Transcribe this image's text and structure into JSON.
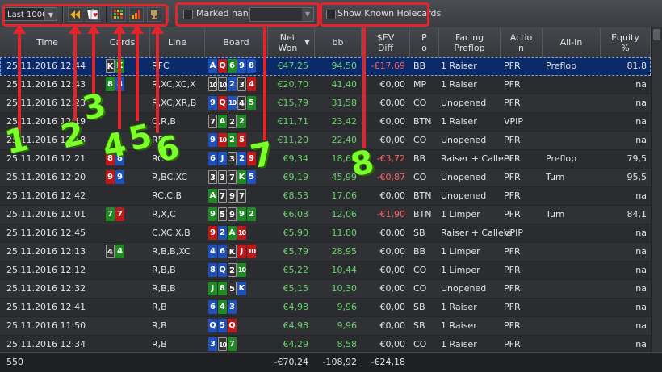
{
  "toolbar": {
    "filter_select": "Last 1000",
    "marked_hands_label": "Marked hands",
    "marked_hands_value": "",
    "show_known_label": "Show Known Holecards"
  },
  "columns": [
    {
      "key": "time",
      "label": "Time"
    },
    {
      "key": "cards",
      "label": "Cards"
    },
    {
      "key": "line",
      "label": "Line"
    },
    {
      "key": "board",
      "label": "Board"
    },
    {
      "key": "net",
      "label": "Net Won"
    },
    {
      "key": "bb",
      "label": "bb"
    },
    {
      "key": "ev",
      "label": "$EV Diff"
    },
    {
      "key": "pos",
      "label": "P o"
    },
    {
      "key": "facing",
      "label": "Facing Preflop"
    },
    {
      "key": "action",
      "label": "Actio n"
    },
    {
      "key": "allin",
      "label": "All-In"
    },
    {
      "key": "equity",
      "label": "Equity %"
    }
  ],
  "rows": [
    {
      "time": "25.11.2016 12:44",
      "cards": [
        [
          "K",
          "s"
        ],
        [
          "K",
          "c"
        ]
      ],
      "line": "RFC",
      "board": [
        [
          "A",
          "d"
        ],
        [
          "Q",
          "h"
        ],
        [
          "6",
          "c"
        ],
        [
          "9",
          "d"
        ],
        [
          "8",
          "d"
        ]
      ],
      "net": "€47,25",
      "bb": "94,50",
      "ev": "-€17,69",
      "ev_neg": true,
      "pos": "BB",
      "facing": "1 Raiser",
      "action": "PFR",
      "allin": "Preflop",
      "equity": "81,8"
    },
    {
      "time": "25.11.2016 12:43",
      "cards": [
        [
          "8",
          "c"
        ],
        [
          "8",
          "d"
        ]
      ],
      "line": "R,XC,XC,X",
      "board": [
        [
          "10",
          "s"
        ],
        [
          "10",
          "s"
        ],
        [
          "2",
          "d"
        ],
        [
          "3",
          "s"
        ],
        [
          "4",
          "h"
        ]
      ],
      "net": "€20,70",
      "bb": "41,40",
      "ev": "€0,00",
      "pos": "MP",
      "facing": "1 Raiser",
      "action": "PFR",
      "allin": "",
      "equity": "na"
    },
    {
      "time": "25.11.2016 12:23",
      "cards": [],
      "line": "R,XC,XR,B",
      "board": [
        [
          "9",
          "d"
        ],
        [
          "Q",
          "h"
        ],
        [
          "10",
          "d"
        ],
        [
          "4",
          "s"
        ],
        [
          "5",
          "c"
        ]
      ],
      "net": "€15,79",
      "bb": "31,58",
      "ev": "€0,00",
      "pos": "CO",
      "facing": "Unopened",
      "action": "PFR",
      "allin": "",
      "equity": "na"
    },
    {
      "time": "25.11.2016 12:19",
      "cards": [],
      "line": "C,R,B",
      "board": [
        [
          "7",
          "s"
        ],
        [
          "A",
          "c"
        ],
        [
          "2",
          "s"
        ],
        [
          "2",
          "c"
        ]
      ],
      "net": "€11,71",
      "bb": "23,42",
      "ev": "€0,00",
      "pos": "BTN",
      "facing": "1 Raiser",
      "action": "VPIP",
      "allin": "",
      "equity": "na"
    },
    {
      "time": "25.11.2016 12:18",
      "cards": [],
      "line": "RB",
      "board": [
        [
          "9",
          "d"
        ],
        [
          "10",
          "h"
        ],
        [
          "2",
          "c"
        ],
        [
          "5",
          "h"
        ]
      ],
      "net": "€11,20",
      "bb": "22,40",
      "ev": "€0,00",
      "pos": "CO",
      "facing": "Unopened",
      "action": "PFR",
      "allin": "",
      "equity": "na"
    },
    {
      "time": "25.11.2016 12:21",
      "cards": [
        [
          "8",
          "h"
        ],
        [
          "8",
          "d"
        ]
      ],
      "line": "RC",
      "board": [
        [
          "6",
          "d"
        ],
        [
          "J",
          "d"
        ],
        [
          "3",
          "s"
        ],
        [
          "2",
          "d"
        ],
        [
          "9",
          "h"
        ]
      ],
      "net": "€9,34",
      "bb": "18,68",
      "ev": "-€3,72",
      "ev_neg": true,
      "pos": "BB",
      "facing": "Raiser + Callers",
      "action": "PFR",
      "allin": "Preflop",
      "equity": "79,5"
    },
    {
      "time": "25.11.2016 12:20",
      "cards": [
        [
          "9",
          "h"
        ],
        [
          "9",
          "d"
        ]
      ],
      "line": "R,BC,XC",
      "board": [
        [
          "3",
          "s"
        ],
        [
          "3",
          "s"
        ],
        [
          "7",
          "s"
        ],
        [
          "K",
          "c"
        ],
        [
          "5",
          "d"
        ]
      ],
      "net": "€9,19",
      "bb": "45,99",
      "ev": "-€0,87",
      "ev_neg": true,
      "pos": "CO",
      "facing": "Unopened",
      "action": "PFR",
      "allin": "Turn",
      "equity": "95,5"
    },
    {
      "time": "25.11.2016 12:42",
      "cards": [],
      "line": "RC,C,B",
      "board": [
        [
          "A",
          "c"
        ],
        [
          "7",
          "s"
        ],
        [
          "9",
          "s"
        ],
        [
          "7",
          "s"
        ]
      ],
      "net": "€8,53",
      "bb": "17,06",
      "ev": "€0,00",
      "pos": "BTN",
      "facing": "Unopened",
      "action": "PFR",
      "allin": "",
      "equity": "na"
    },
    {
      "time": "25.11.2016 12:01",
      "cards": [
        [
          "7",
          "c"
        ],
        [
          "7",
          "h"
        ]
      ],
      "line": "R,X,C",
      "board": [
        [
          "9",
          "c"
        ],
        [
          "5",
          "s"
        ],
        [
          "9",
          "s"
        ],
        [
          "9",
          "c"
        ],
        [
          "2",
          "c"
        ]
      ],
      "net": "€6,03",
      "bb": "12,06",
      "ev": "-€1,90",
      "ev_neg": true,
      "pos": "BTN",
      "facing": "1 Limper",
      "action": "PFR",
      "allin": "Turn",
      "equity": "84,1"
    },
    {
      "time": "25.11.2016 12:45",
      "cards": [],
      "line": "C,XC,X,B",
      "board": [
        [
          "9",
          "h"
        ],
        [
          "2",
          "d"
        ],
        [
          "A",
          "c"
        ],
        [
          "10",
          "h"
        ]
      ],
      "net": "€5,90",
      "bb": "11,80",
      "ev": "€0,00",
      "pos": "SB",
      "facing": "Raiser + Callers",
      "action": "VPIP",
      "allin": "",
      "equity": "na"
    },
    {
      "time": "25.11.2016 12:13",
      "cards": [
        [
          "4",
          "s"
        ],
        [
          "4",
          "c"
        ]
      ],
      "line": "R,B,B,XC",
      "board": [
        [
          "4",
          "d"
        ],
        [
          "6",
          "d"
        ],
        [
          "K",
          "s"
        ],
        [
          "J",
          "h"
        ],
        [
          "10",
          "h"
        ]
      ],
      "net": "€5,79",
      "bb": "28,95",
      "ev": "€0,00",
      "pos": "BB",
      "facing": "1 Limper",
      "action": "PFR",
      "allin": "",
      "equity": "na"
    },
    {
      "time": "25.11.2016 12:12",
      "cards": [],
      "line": "R,B,B",
      "board": [
        [
          "8",
          "d"
        ],
        [
          "Q",
          "d"
        ],
        [
          "2",
          "s"
        ],
        [
          "10",
          "c"
        ]
      ],
      "net": "€5,22",
      "bb": "10,44",
      "ev": "€0,00",
      "pos": "CO",
      "facing": "1 Limper",
      "action": "PFR",
      "allin": "",
      "equity": "na"
    },
    {
      "time": "25.11.2016 12:32",
      "cards": [],
      "line": "R,B,B",
      "board": [
        [
          "J",
          "c"
        ],
        [
          "8",
          "c"
        ],
        [
          "5",
          "s"
        ],
        [
          "K",
          "d"
        ]
      ],
      "net": "€5,15",
      "bb": "10,30",
      "ev": "€0,00",
      "pos": "CO",
      "facing": "Unopened",
      "action": "PFR",
      "allin": "",
      "equity": "na"
    },
    {
      "time": "25.11.2016 12:41",
      "cards": [],
      "line": "R,B",
      "board": [
        [
          "6",
          "d"
        ],
        [
          "4",
          "c"
        ],
        [
          "3",
          "d"
        ]
      ],
      "net": "€4,98",
      "bb": "9,96",
      "ev": "€0,00",
      "pos": "SB",
      "facing": "1 Raiser",
      "action": "PFR",
      "allin": "",
      "equity": "na"
    },
    {
      "time": "25.11.2016 11:50",
      "cards": [],
      "line": "R,B",
      "board": [
        [
          "Q",
          "d"
        ],
        [
          "5",
          "d"
        ],
        [
          "Q",
          "h"
        ]
      ],
      "net": "€4,98",
      "bb": "9,96",
      "ev": "€0,00",
      "pos": "SB",
      "facing": "1 Raiser",
      "action": "PFR",
      "allin": "",
      "equity": "na"
    },
    {
      "time": "25.11.2016 12:34",
      "cards": [],
      "line": "R,B",
      "board": [
        [
          "3",
          "d"
        ],
        [
          "10",
          "s"
        ],
        [
          "7",
          "c"
        ]
      ],
      "net": "€4,29",
      "bb": "8,58",
      "ev": "€0,00",
      "pos": "CO",
      "facing": "1 Raiser",
      "action": "PFR",
      "allin": "",
      "equity": "na"
    }
  ],
  "footer": {
    "count": "550",
    "net": "-€70,24",
    "bb": "-108,92",
    "ev": "-€24,18"
  },
  "annotations": [
    "1",
    "2",
    "3",
    "4",
    "5",
    "6",
    "7",
    "8"
  ],
  "colors": {
    "spade": "#333333",
    "heart": "#c01818",
    "diamond": "#1f4fb8",
    "club": "#1d8a22",
    "positive": "#6ad06a",
    "negative": "#ff6060",
    "selection": "#0a2a6a",
    "callout": "#e4242b",
    "number": "#7cff2a"
  }
}
